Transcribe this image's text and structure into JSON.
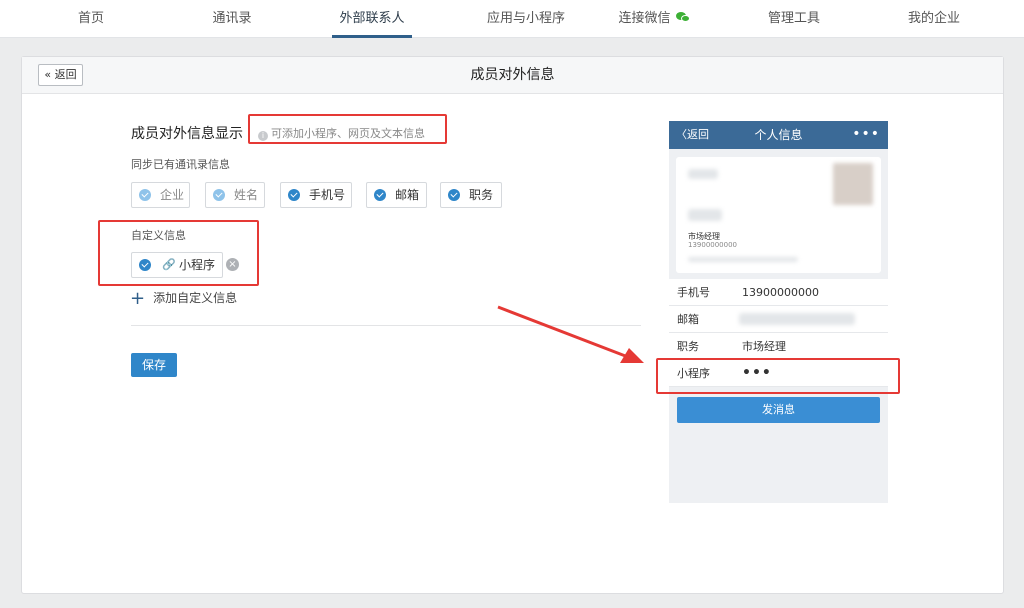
{
  "nav": {
    "items": [
      {
        "label": "首页"
      },
      {
        "label": "通讯录"
      },
      {
        "label": "外部联系人"
      },
      {
        "label": "应用与小程序"
      },
      {
        "label": "连接微信"
      },
      {
        "label": "管理工具"
      },
      {
        "label": "我的企业"
      }
    ],
    "active_index": 2
  },
  "header": {
    "back_label": "« 返回",
    "title": "成员对外信息"
  },
  "form": {
    "section_title": "成员对外信息显示",
    "hint": "可添加小程序、网页及文本信息",
    "sync_label": "同步已有通讯录信息",
    "sync_fields": [
      {
        "label": "企业",
        "checked": true,
        "disabled": true
      },
      {
        "label": "姓名",
        "checked": true,
        "disabled": true
      },
      {
        "label": "手机号",
        "checked": true,
        "disabled": false
      },
      {
        "label": "邮箱",
        "checked": true,
        "disabled": false
      },
      {
        "label": "职务",
        "checked": true,
        "disabled": false
      }
    ],
    "custom_label": "自定义信息",
    "custom_item": "小程序",
    "add_custom_label": "添加自定义信息",
    "save_label": "保存"
  },
  "preview": {
    "back_label": "〈返回",
    "title": "个人信息",
    "more": "•••",
    "card_role": "市场经理",
    "card_phone": "13900000000",
    "rows": [
      {
        "key": "手机号",
        "value": "13900000000"
      },
      {
        "key": "邮箱",
        "value": ""
      },
      {
        "key": "职务",
        "value": "市场经理"
      },
      {
        "key": "小程序",
        "value": "•••"
      }
    ],
    "send_label": "发消息"
  },
  "colors": {
    "primary": "#2f86c9",
    "phone_header": "#3b6a97",
    "highlight": "#e53935",
    "wechat_green": "#3cb035"
  }
}
